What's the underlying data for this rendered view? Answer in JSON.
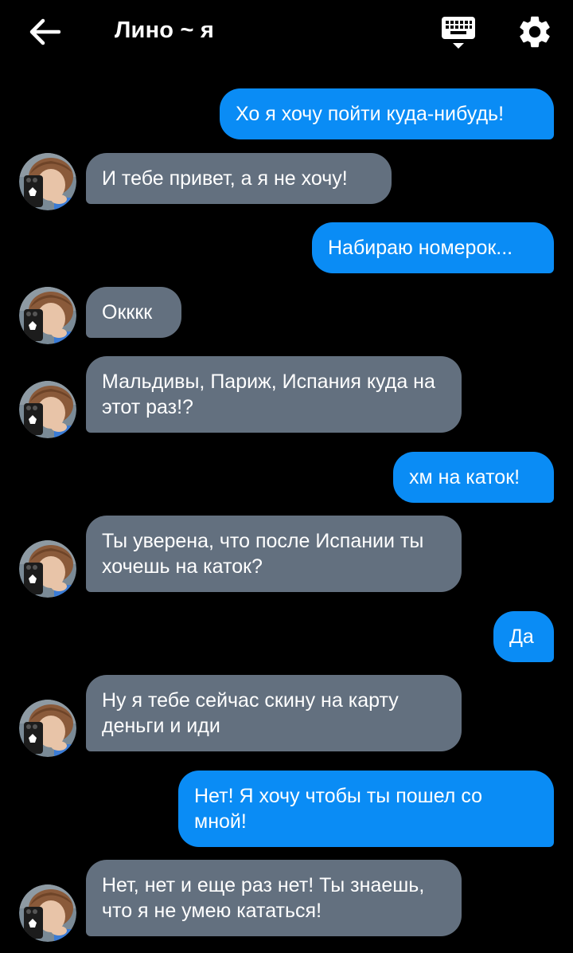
{
  "header": {
    "title": "Лино ~ я",
    "back_icon": "arrow-left-icon",
    "keyboard_icon": "keyboard-icon",
    "settings_icon": "gear-icon"
  },
  "colors": {
    "background": "#000000",
    "outgoing_bubble": "#0a8cf5",
    "incoming_bubble": "#63707f"
  },
  "messages": [
    {
      "side": "out",
      "text": "Хо я хочу пойти куда-нибудь!"
    },
    {
      "side": "in",
      "text": "И тебе привет, а я не хочу!"
    },
    {
      "side": "out",
      "text": "Набираю номерок..."
    },
    {
      "side": "in",
      "text": "Окккк"
    },
    {
      "side": "in",
      "text": "Мальдивы, Париж, Испания куда на этот раз!?"
    },
    {
      "side": "out",
      "text": "хм на каток!"
    },
    {
      "side": "in",
      "text": "Ты уверена, что после Испании ты хочешь на каток?"
    },
    {
      "side": "out",
      "text": "Да"
    },
    {
      "side": "in",
      "text": "Ну я тебе сейчас скину на карту деньги и иди"
    },
    {
      "side": "out",
      "text": "Нет! Я хочу чтобы ты пошел со мной!"
    },
    {
      "side": "in",
      "text": "Нет, нет и еще раз нет! Ты знаешь, что я не умею кататься!"
    }
  ]
}
